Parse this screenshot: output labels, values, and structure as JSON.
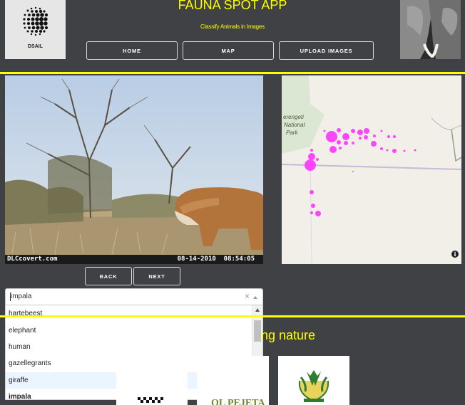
{
  "header": {
    "title": "FAUNA SPOT APP",
    "subtitle": "Classify Animals in Images",
    "left_logo_text": "DSAIL",
    "left_logo_icon": "halftone-dots-logo",
    "right_logo_icon": "elephant-photo"
  },
  "nav": {
    "home": "HOME",
    "map": "MAP",
    "upload": "UPLOAD IMAGES"
  },
  "camera_image": {
    "source_label": "DLCcovert.com",
    "timestamp": "08-14-2010  08:54:05",
    "subject": "impala"
  },
  "map": {
    "labels": [
      "erengeti",
      "National",
      "Park"
    ],
    "info_icon": "i"
  },
  "pager": {
    "back": "BACK",
    "next": "NEXT"
  },
  "species_select": {
    "value": "impala",
    "clear_symbol": "×",
    "options": [
      "hartebeest",
      "elephant",
      "human",
      "gazellegrants",
      "giraffe",
      "impala"
    ],
    "highlighted": "giraffe",
    "selected": "impala"
  },
  "partners": {
    "heading_fragment": "ng nature",
    "logos": [
      "checkered-logo",
      "ol-pejeta-logo",
      "conservancy-crest-logo"
    ],
    "ol_pejeta_text": "OL PEJETA"
  },
  "colors": {
    "accent": "#ffff00",
    "background": "#3f4144",
    "map_marker": "#ff33ff"
  }
}
